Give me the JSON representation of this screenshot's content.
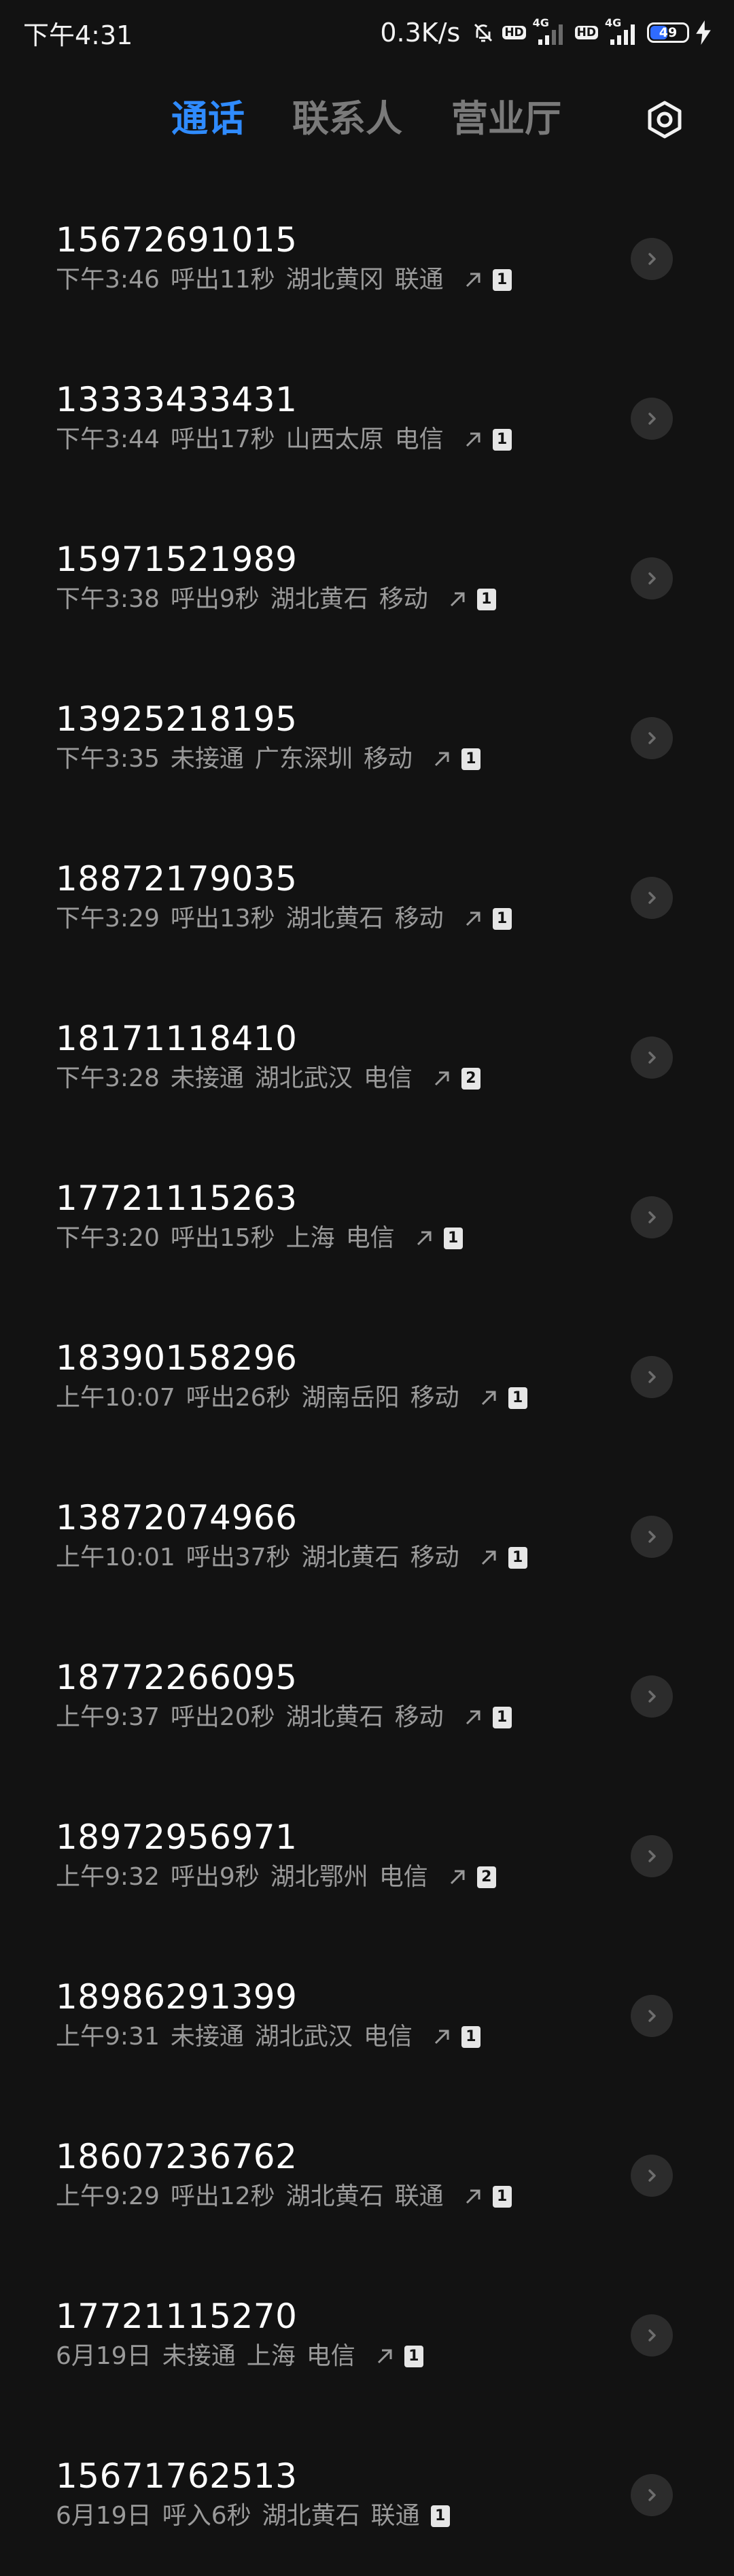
{
  "status_bar": {
    "time": "下午4:31",
    "net_speed": "0.3K/s",
    "icons": [
      "mute-bell-icon",
      "hd-icon",
      "signal-4g-icon",
      "hd-icon",
      "signal-4g-icon",
      "battery-icon",
      "charging-bolt-icon"
    ],
    "hd_label": "HD",
    "network_label": "4G",
    "battery_percent": 49,
    "battery_label": "49"
  },
  "tabs": [
    {
      "label": "通话",
      "active": true
    },
    {
      "label": "联系人",
      "active": false
    },
    {
      "label": "营业厅",
      "active": false
    }
  ],
  "settings_icon": "settings-gear-icon",
  "accent_color": "#2f8bff",
  "calls": [
    {
      "number": "15672691015",
      "time": "下午3:46",
      "status": "呼出11秒",
      "location": "湖北黄冈",
      "carrier": "联通",
      "direction_icon": "outgoing-arrow-icon",
      "sim": "1"
    },
    {
      "number": "13333433431",
      "time": "下午3:44",
      "status": "呼出17秒",
      "location": "山西太原",
      "carrier": "电信",
      "direction_icon": "outgoing-arrow-icon",
      "sim": "1"
    },
    {
      "number": "15971521989",
      "time": "下午3:38",
      "status": "呼出9秒",
      "location": "湖北黄石",
      "carrier": "移动",
      "direction_icon": "outgoing-arrow-icon",
      "sim": "1"
    },
    {
      "number": "13925218195",
      "time": "下午3:35",
      "status": "未接通",
      "location": "广东深圳",
      "carrier": "移动",
      "direction_icon": "outgoing-arrow-icon",
      "sim": "1"
    },
    {
      "number": "18872179035",
      "time": "下午3:29",
      "status": "呼出13秒",
      "location": "湖北黄石",
      "carrier": "移动",
      "direction_icon": "outgoing-arrow-icon",
      "sim": "1"
    },
    {
      "number": "18171118410",
      "time": "下午3:28",
      "status": "未接通",
      "location": "湖北武汉",
      "carrier": "电信",
      "direction_icon": "outgoing-arrow-icon",
      "sim": "2"
    },
    {
      "number": "17721115263",
      "time": "下午3:20",
      "status": "呼出15秒",
      "location": "上海",
      "carrier": "电信",
      "direction_icon": "outgoing-arrow-icon",
      "sim": "1"
    },
    {
      "number": "18390158296",
      "time": "上午10:07",
      "status": "呼出26秒",
      "location": "湖南岳阳",
      "carrier": "移动",
      "direction_icon": "outgoing-arrow-icon",
      "sim": "1"
    },
    {
      "number": "13872074966",
      "time": "上午10:01",
      "status": "呼出37秒",
      "location": "湖北黄石",
      "carrier": "移动",
      "direction_icon": "outgoing-arrow-icon",
      "sim": "1"
    },
    {
      "number": "18772266095",
      "time": "上午9:37",
      "status": "呼出20秒",
      "location": "湖北黄石",
      "carrier": "移动",
      "direction_icon": "outgoing-arrow-icon",
      "sim": "1"
    },
    {
      "number": "18972956971",
      "time": "上午9:32",
      "status": "呼出9秒",
      "location": "湖北鄂州",
      "carrier": "电信",
      "direction_icon": "outgoing-arrow-icon",
      "sim": "2"
    },
    {
      "number": "18986291399",
      "time": "上午9:31",
      "status": "未接通",
      "location": "湖北武汉",
      "carrier": "电信",
      "direction_icon": "outgoing-arrow-icon",
      "sim": "1"
    },
    {
      "number": "18607236762",
      "time": "上午9:29",
      "status": "呼出12秒",
      "location": "湖北黄石",
      "carrier": "联通",
      "direction_icon": "outgoing-arrow-icon",
      "sim": "1"
    },
    {
      "number": "17721115270",
      "time": "6月19日",
      "status": "未接通",
      "location": "上海",
      "carrier": "电信",
      "direction_icon": "outgoing-arrow-icon",
      "sim": "1"
    },
    {
      "number": "15671762513",
      "time": "6月19日",
      "status": "呼入6秒",
      "location": "湖北黄石",
      "carrier": "联通",
      "direction_icon": "",
      "sim": "1"
    }
  ],
  "row_icon": "chevron-right-icon"
}
